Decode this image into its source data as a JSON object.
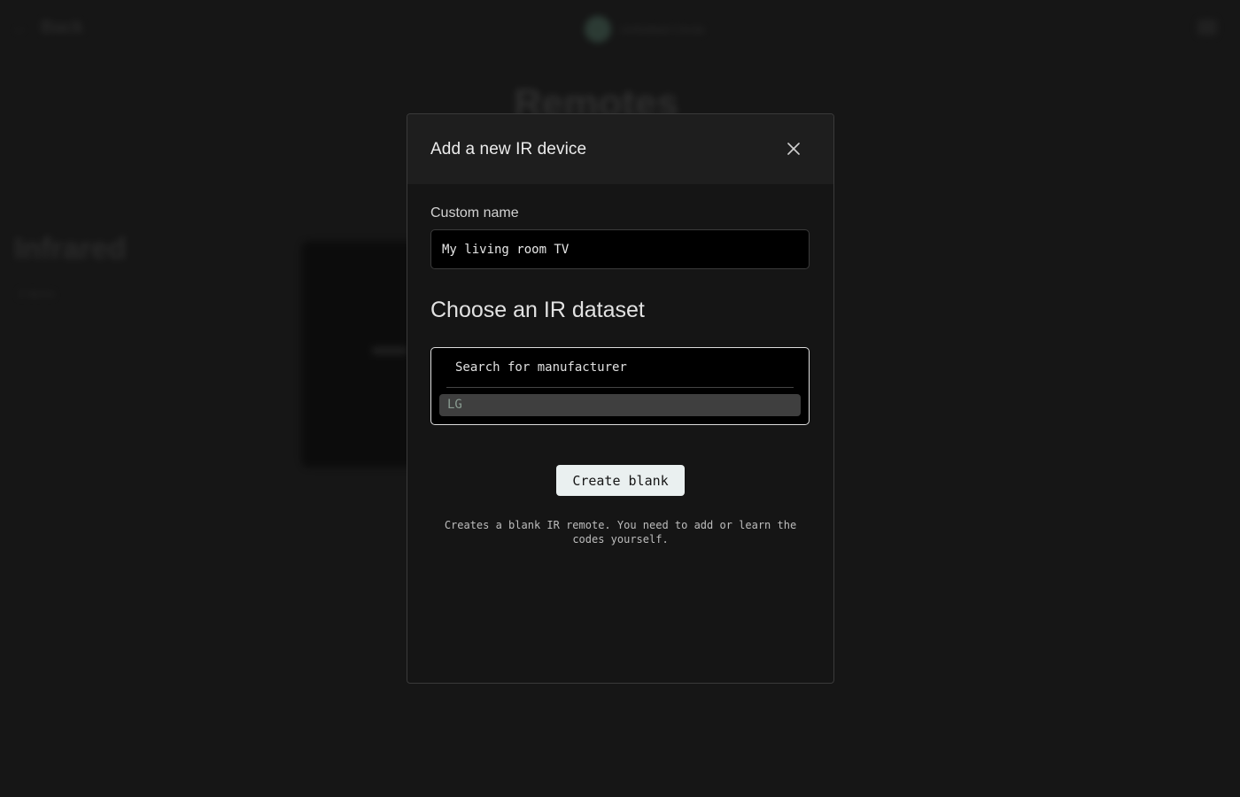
{
  "background": {
    "back_label": "Back",
    "logo_text": "Unfolded Circle",
    "page_title": "Remotes",
    "section_title": "Infrared",
    "section_sub": "2 items"
  },
  "modal": {
    "title": "Add a new IR device",
    "close_icon": "close-icon",
    "custom_name": {
      "label": "Custom name",
      "value": "My living room TV"
    },
    "dataset": {
      "heading": "Choose an IR dataset",
      "search_placeholder": "Search for manufacturer",
      "options": [
        "LG"
      ]
    },
    "create_blank_label": "Create blank",
    "help_text": "Creates a blank IR remote. You need to add or learn the codes yourself."
  },
  "colors": {
    "background": "#161616",
    "modal_bg": "#151515",
    "header_bg": "#1e1e1e",
    "button_bg": "#eaf0f0",
    "option_bg": "#3f3f3f",
    "option_text": "#8a9c92"
  }
}
